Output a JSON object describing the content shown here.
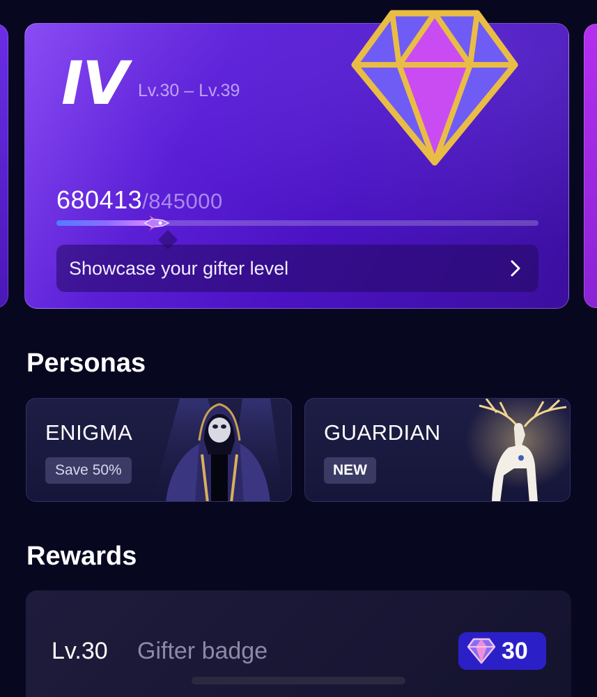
{
  "level_card": {
    "tier": "IV",
    "level_range": "Lv.30 – Lv.39",
    "progress_current": "680413",
    "progress_max": "/845000",
    "progress_fraction": 0.206,
    "showcase_label": "Showcase your gifter level"
  },
  "personas": {
    "title": "Personas",
    "items": [
      {
        "name": "ENIGMA",
        "tag": "Save 50%"
      },
      {
        "name": "GUARDIAN",
        "tag": "NEW"
      }
    ]
  },
  "rewards": {
    "title": "Rewards",
    "items": [
      {
        "level": "Lv.30",
        "name": "Gifter badge",
        "badge_value": "30"
      }
    ]
  },
  "colors": {
    "background": "#080720",
    "card_purple": "#5b1fd6",
    "badge_blue": "#2b20c8",
    "diamond_gold": "#e8b93a"
  }
}
